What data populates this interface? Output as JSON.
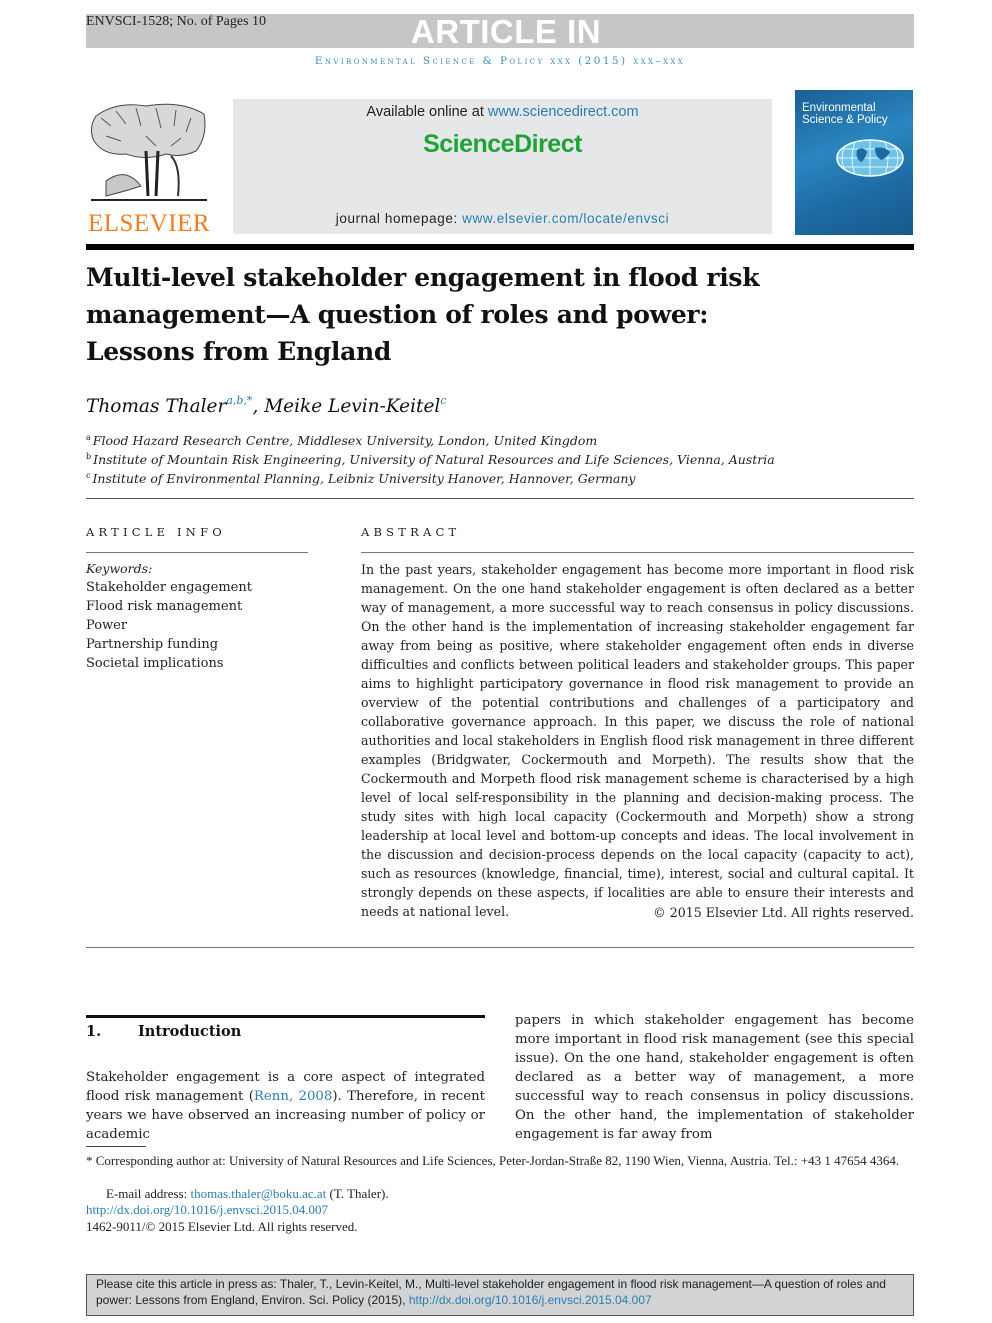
{
  "top": {
    "code": "ENVSCI-1528; No. of Pages 10",
    "banner": "ARTICLE IN PRESS",
    "running_head": "Environmental Science & Policy xxx (2015) xxx–xxx"
  },
  "header": {
    "publisher_logo_text": "ELSEVIER",
    "available_prefix": "Available online at ",
    "available_link": "www.sciencedirect.com",
    "brand": "ScienceDirect",
    "homepage_prefix": "journal homepage: ",
    "homepage_link": "www.elsevier.com/locate/envsci",
    "cover_title": "Environmental Science & Policy"
  },
  "article": {
    "title": "Multi-level stakeholder engagement in flood risk management—A question of roles and power: Lessons from England",
    "authors": [
      {
        "name": "Thomas Thaler",
        "marks": "a,b,*"
      },
      {
        "name": "Meike Levin-Keitel",
        "marks": "c"
      }
    ],
    "author_separator": ", ",
    "affiliations": [
      {
        "mark": "a",
        "text": "Flood Hazard Research Centre, Middlesex University, London, United Kingdom"
      },
      {
        "mark": "b",
        "text": "Institute of Mountain Risk Engineering, University of Natural Resources and Life Sciences, Vienna, Austria"
      },
      {
        "mark": "c",
        "text": "Institute of Environmental Planning, Leibniz University Hanover, Hannover, Germany"
      }
    ]
  },
  "article_info": {
    "label": "ARTICLE INFO",
    "keywords_label": "Keywords:",
    "keywords": [
      "Stakeholder engagement",
      "Flood risk management",
      "Power",
      "Partnership funding",
      "Societal implications"
    ]
  },
  "abstract": {
    "label": "ABSTRACT",
    "text": "In the past years, stakeholder engagement has become more important in flood risk management. On the one hand stakeholder engagement is often declared as a better way of management, a more successful way to reach consensus in policy discussions. On the other hand is the implementation of increasing stakeholder engagement far away from being as positive, where stakeholder engagement often ends in diverse difficulties and conflicts between political leaders and stakeholder groups. This paper aims to highlight participatory governance in flood risk management to provide an overview of the potential contributions and challenges of a participatory and collaborative governance approach. In this paper, we discuss the role of national authorities and local stakeholders in English flood risk management in three different examples (Bridgwater, Cockermouth and Morpeth). The results show that the Cockermouth and Morpeth flood risk management scheme is characterised by a high level of local self-responsibility in the planning and decision-making process. The study sites with high local capacity (Cockermouth and Morpeth) show a strong leadership at local level and bottom-up concepts and ideas. The local involvement in the discussion and decision-process depends on the local capacity (capacity to act), such as resources (knowledge, financial, time), interest, social and cultural capital. It strongly depends on these aspects, if localities are able to ensure their interests and needs at national level.",
    "copyright": "© 2015 Elsevier Ltd. All rights reserved."
  },
  "introduction": {
    "number": "1.",
    "title": "Introduction",
    "col1_before": "Stakeholder engagement is a core aspect of integrated flood risk management (",
    "col1_cite": "Renn, 2008",
    "col1_after": "). Therefore, in recent years we have observed an increasing number of policy or academic",
    "col2": "papers in which stakeholder engagement has become more important in flood risk management (see this special issue). On the one hand, stakeholder engagement is often declared as a better way of management, a more successful way to reach consensus in policy discussions. On the other hand, the implementation of stakeholder engagement is far away from"
  },
  "footnotes": {
    "corresponding": "* Corresponding author at: University of Natural Resources and Life Sciences, Peter-Jordan-Straße 82, 1190 Wien, Vienna, Austria. Tel.: +43 1 47654 4364.",
    "email_label": "E-mail address: ",
    "email": "thomas.thaler@boku.ac.at",
    "email_suffix": " (T. Thaler).",
    "doi": "http://dx.doi.org/10.1016/j.envsci.2015.04.007",
    "issn": "1462-9011/© 2015 Elsevier Ltd. All rights reserved."
  },
  "citation_box": {
    "text": "Please cite this article in press as: Thaler, T., Levin-Keitel, M., Multi-level stakeholder engagement in flood risk management—A question of roles and power: Lessons from England, Environ. Sci. Policy (2015), ",
    "link": "http://dx.doi.org/10.1016/j.envsci.2015.04.007"
  },
  "colors": {
    "link": "#2a7db0",
    "elsevier_orange": "#f47b20",
    "sciencedirect_green": "#1ea436",
    "banner_gray": "#c6c6c6"
  }
}
